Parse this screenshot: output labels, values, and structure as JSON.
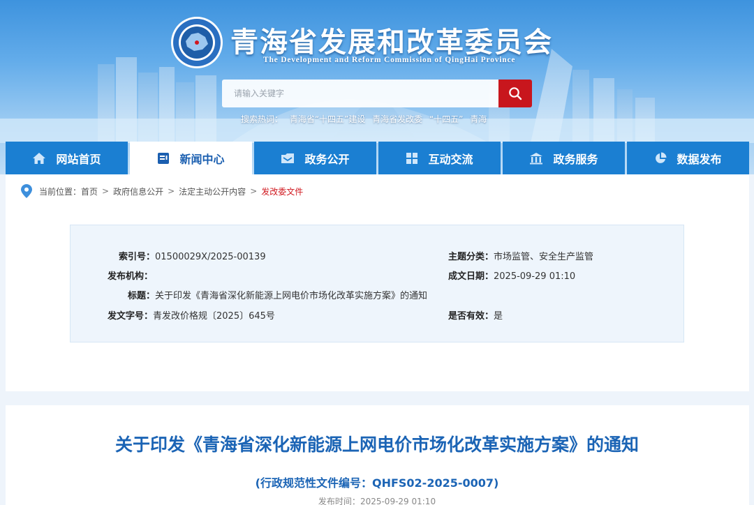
{
  "header": {
    "title": "青海省发展和改革委员会",
    "subtitle": "The Development and Reform Commission of QingHai Province",
    "search_placeholder": "请输入关键字",
    "hotwords_label": "搜索热词：",
    "hotwords": [
      "青海省“十四五”建设",
      "青海省发改委",
      "“十四五”",
      "青海"
    ]
  },
  "nav": {
    "items": [
      {
        "label": "网站首页",
        "icon": "home-icon"
      },
      {
        "label": "新闻中心",
        "icon": "news-icon"
      },
      {
        "label": "政务公开",
        "icon": "folder-icon"
      },
      {
        "label": "互动交流",
        "icon": "grid-icon"
      },
      {
        "label": "政务服务",
        "icon": "building-icon"
      },
      {
        "label": "数据发布",
        "icon": "pie-chart-icon"
      }
    ],
    "active_index": 1
  },
  "breadcrumb": {
    "prefix": "当前位置：",
    "items": [
      "首页",
      "政府信息公开",
      "法定主动公开内容",
      "发改委文件"
    ]
  },
  "meta": {
    "index_label": "索引号：",
    "index_value": "01500029X/2025-00139",
    "topic_label": "主题分类：",
    "topic_value": "市场监管、安全生产监管",
    "publisher_label": "发布机构：",
    "publisher_value": "",
    "date_label": "成文日期：",
    "date_value": "2025-09-29 01:10",
    "title_label": "标题：",
    "title_value": "关于印发《青海省深化新能源上网电价市场化改革实施方案》的通知",
    "docno_label": "发文字号：",
    "docno_value": "青发改价格规〔2025〕645号",
    "valid_label": "是否有效：",
    "valid_value": "是"
  },
  "article": {
    "title": "关于印发《青海省深化新能源上网电价市场化改革实施方案》的通知",
    "subtitle": "(行政规范性文件编号：QHFS02-2025-0007)",
    "date_label": "发布时间：",
    "date_value": "2025-09-29 01:10"
  },
  "colors": {
    "nav_blue": "#1b7fd2",
    "title_blue": "#1b64b5",
    "search_red": "#c8161d",
    "breadcrumb_current": "#d0181f"
  }
}
